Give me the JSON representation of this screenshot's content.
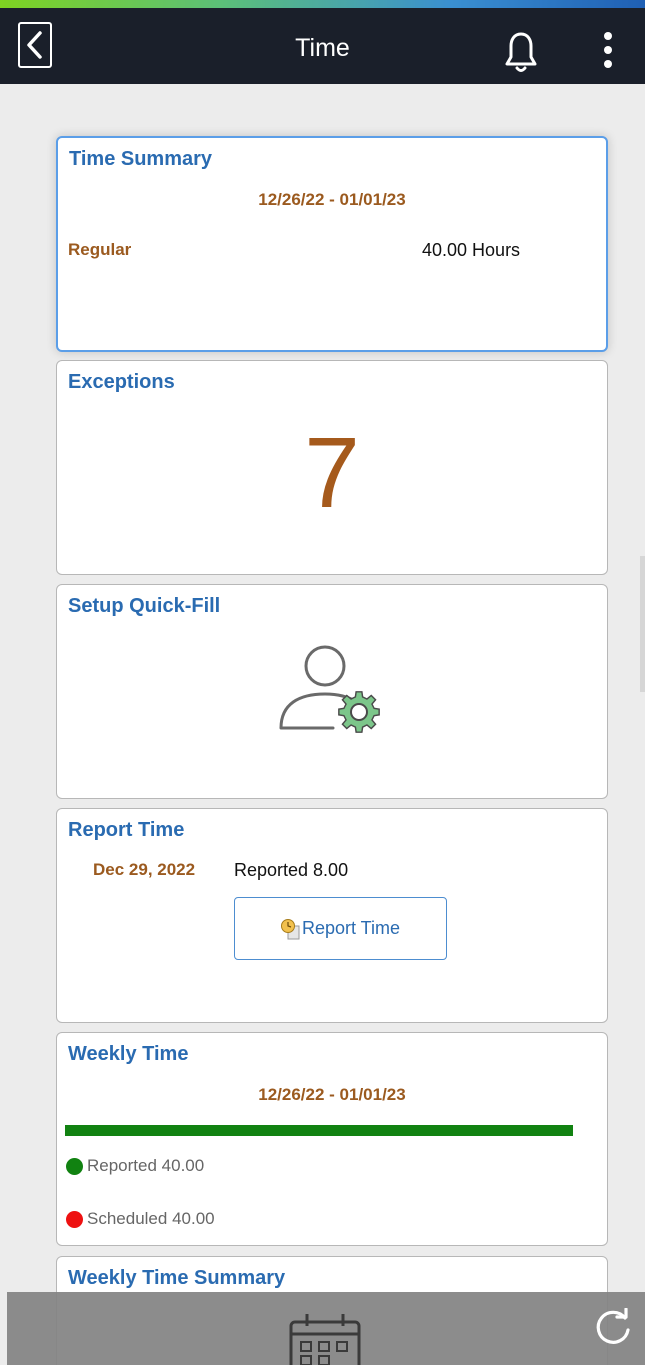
{
  "header": {
    "title": "Time"
  },
  "tiles": {
    "time_summary": {
      "title": "Time Summary",
      "period": "12/26/22 - 01/01/23",
      "rows": [
        {
          "label": "Regular",
          "value": "40.00 Hours"
        }
      ]
    },
    "exceptions": {
      "title": "Exceptions",
      "count": "7"
    },
    "quick_fill": {
      "title": "Setup Quick-Fill",
      "icon": "user-gear-icon"
    },
    "report_time": {
      "title": "Report Time",
      "date": "Dec 29, 2022",
      "reported": "Reported 8.00",
      "button_label": "Report Time"
    },
    "weekly_time": {
      "title": "Weekly Time",
      "period": "12/26/22 - 01/01/23",
      "progress": 1.0,
      "legend": [
        {
          "label": "Reported 40.00",
          "color": "#118211"
        },
        {
          "label": "Scheduled 40.00",
          "color": "#ee1111"
        }
      ]
    },
    "weekly_time_summary": {
      "title": "Weekly Time Summary"
    }
  },
  "colors": {
    "accent": "#2a6bb1",
    "date_text": "#9b5a1f",
    "header_bg": "#1a1f2a"
  }
}
